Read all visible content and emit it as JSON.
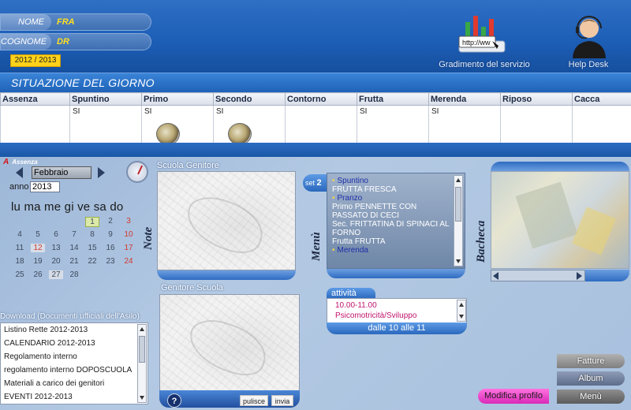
{
  "header": {
    "nome_label": "NOME",
    "nome_value": "FRA",
    "cognome_label": "COGNOME",
    "cognome_value": "DR",
    "school_year": "2012  /  2013",
    "tools": [
      {
        "label": "Gradimento del servizio",
        "icon": "survey-icon"
      },
      {
        "label": "Help Desk",
        "icon": "helpdesk-icon"
      }
    ]
  },
  "situation": {
    "title": "SITUAZIONE DEL GIORNO",
    "columns": [
      "Assenza",
      "Spuntino",
      "Primo",
      "Secondo",
      "Contorno",
      "Frutta",
      "Merenda",
      "Riposo",
      "Cacca"
    ],
    "values": [
      "",
      "SI",
      "SI",
      "SI",
      "",
      "SI",
      "SI",
      "",
      ""
    ]
  },
  "calendar": {
    "tag": "Assenza",
    "month": "Febbraio",
    "anno_label": "anno",
    "year": "2013",
    "weekdays": "lu ma me gi ve sa  do",
    "days": [
      "1",
      "2",
      "3",
      "4",
      "5",
      "6",
      "7",
      "8",
      "9",
      "10",
      "11",
      "12",
      "13",
      "14",
      "15",
      "16",
      "17",
      "18",
      "19",
      "20",
      "21",
      "22",
      "23",
      "24",
      "25",
      "26",
      "27",
      "28"
    ]
  },
  "panels": {
    "scuola_genitore": "Scuola Genitore",
    "genitore_scuola": "Genitore Scuola",
    "note": "Note",
    "menu": "Menù",
    "bacheca": "Bacheca"
  },
  "menu": {
    "tab_prefix": "set",
    "tab_number": "2",
    "sections": [
      {
        "head": "Spuntino",
        "lines": [
          "FRUTTA FRESCA"
        ]
      },
      {
        "head": "Pranzo",
        "lines": [
          "Primo PENNETTE CON PASSATO DI CECI",
          "Sec. FRITTATINA DI SPINACI AL FORNO",
          "Frutta FRUTTA"
        ]
      },
      {
        "head": "Merenda",
        "lines": []
      }
    ]
  },
  "attivita": {
    "title": "attività",
    "items": [
      "10.00-11.00",
      "Psicomotricità/Sviluppo"
    ],
    "time": "dalle 10 alle 11"
  },
  "download": {
    "title": "Download (Documenti ufficiali dell'Asilo)",
    "items": [
      "Listino Rette 2012-2013",
      "CALENDARIO 2012-2013",
      "Regolamento interno",
      "regolamento interno DOPOSCUOLA",
      "Materiali a carico dei genitori",
      "EVENTI 2012-2013"
    ]
  },
  "actions": {
    "help": "?",
    "pulisce": "pulisce",
    "invia": "invia",
    "modifica": "Modifica profilo",
    "fatture": "Fatture",
    "album": "Album",
    "menu": "Menù"
  },
  "colors": {
    "nav_fatture": "#8e8e8e",
    "nav_album": "#6d7c98",
    "nav_menu": "#6a6a6a",
    "modifica": "#e63fc8",
    "accent_yellow": "#ffd21a"
  }
}
